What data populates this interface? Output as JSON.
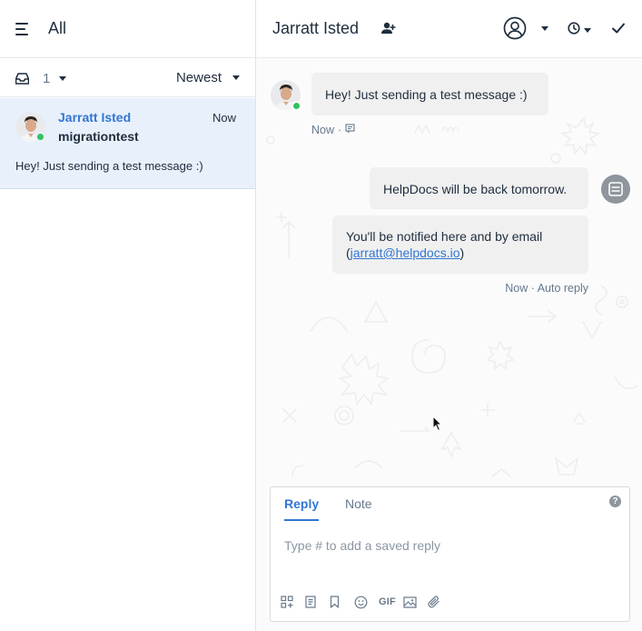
{
  "left_panel": {
    "title": "All",
    "filter": {
      "inbox_count": "1",
      "sort_label": "Newest"
    },
    "conversation": {
      "name": "Jarratt Isted",
      "time": "Now",
      "subject": "migrationtest",
      "preview": "Hey! Just sending a test message :)"
    }
  },
  "header": {
    "contact_name": "Jarratt Isted"
  },
  "messages": {
    "m1": {
      "text": "Hey! Just sending a test message :)",
      "time": "Now",
      "sep": "·"
    },
    "m2": {
      "text": "HelpDocs will be back tomorrow."
    },
    "m3": {
      "prefix": "You'll be notified here and by email (",
      "email": "jarratt@helpdocs.io",
      "suffix": ")"
    },
    "reply_meta": "Now · Auto reply"
  },
  "composer": {
    "tabs": {
      "reply": "Reply",
      "note": "Note"
    },
    "help": "?",
    "placeholder": "Type # to add a saved reply",
    "gif": "GIF"
  },
  "colors": {
    "accent": "#3276d3",
    "online": "#33c15f",
    "selected_row": "#e8f0fc",
    "bubble": "#f0f0f0"
  }
}
